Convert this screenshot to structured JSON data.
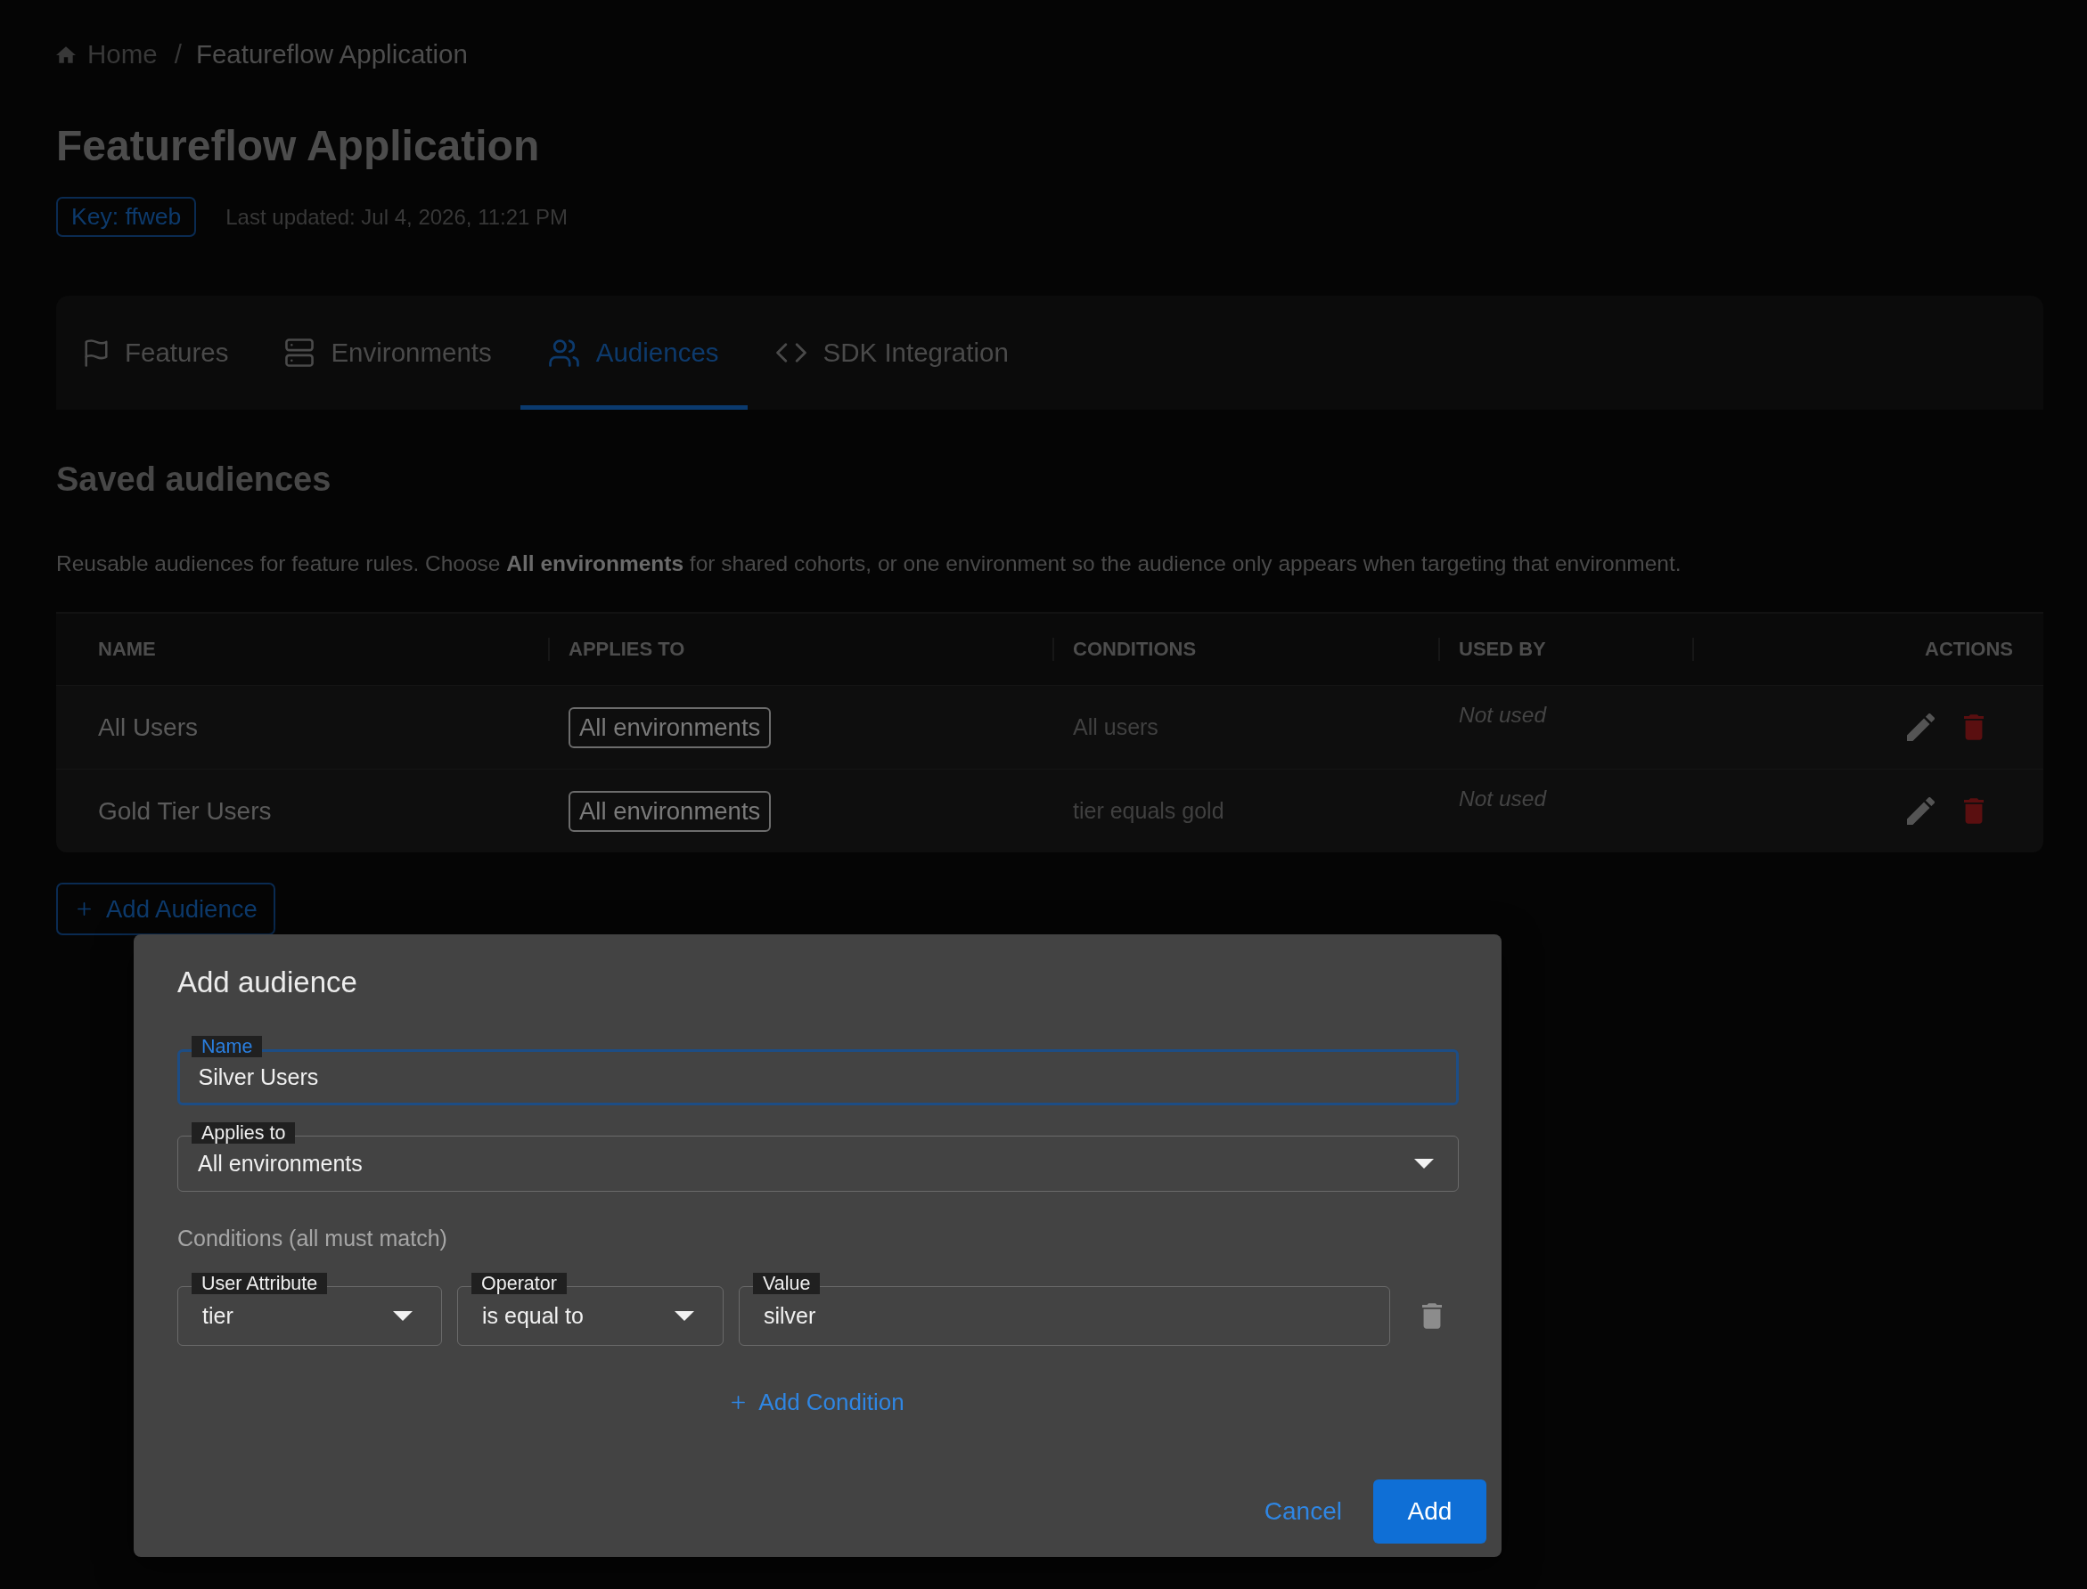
{
  "breadcrumb": {
    "items": [
      {
        "label": "Home",
        "kind": "home"
      },
      {
        "label": "Featureflow Application",
        "kind": "current"
      }
    ],
    "separator": "/"
  },
  "header": {
    "title": "Featureflow Application",
    "key_badge": "Key: ffweb",
    "last_updated": "Last updated: Jul 4, 2026, 11:21 PM"
  },
  "tabs": [
    {
      "label": "Features",
      "selected": false
    },
    {
      "label": "Environments",
      "selected": false
    },
    {
      "label": "Audiences",
      "selected": true
    },
    {
      "label": "SDK Integration",
      "selected": false
    }
  ],
  "section": {
    "title": "Saved audiences",
    "description": "Reusable audiences for feature rules. Choose **All environments** for shared cohorts, or one environment so the audience only appears when targeting that environment."
  },
  "table": {
    "columns": [
      "NAME",
      "APPLIES TO",
      "CONDITIONS",
      "USED BY",
      "ACTIONS"
    ],
    "rows": [
      {
        "name": "All Users",
        "applies_to": "All environments",
        "conditions": "All users",
        "used_by": "Not used"
      },
      {
        "name": "Gold Tier Users",
        "applies_to": "All environments",
        "conditions": "tier equals gold",
        "used_by": "Not used"
      }
    ]
  },
  "add_audience_button": {
    "label": "Add Audience"
  },
  "dialog": {
    "title": "Add audience",
    "fields": [
      {
        "label": "Name",
        "value": "Silver Users",
        "kind": "text",
        "focused": true
      },
      {
        "label": "Applies to",
        "value": "All environments",
        "kind": "select",
        "focused": false
      }
    ],
    "conditions_heading": "Conditions (all must match)",
    "conditions": [
      {
        "attribute": {
          "label": "User Attribute",
          "value": "tier"
        },
        "operator": {
          "label": "Operator",
          "value": "is equal to"
        },
        "value": {
          "label": "Value",
          "value": "silver"
        }
      }
    ],
    "add_condition": "Add Condition",
    "buttons": [
      {
        "label": "Cancel",
        "kind": "text"
      },
      {
        "label": "Add",
        "kind": "primary"
      }
    ]
  }
}
